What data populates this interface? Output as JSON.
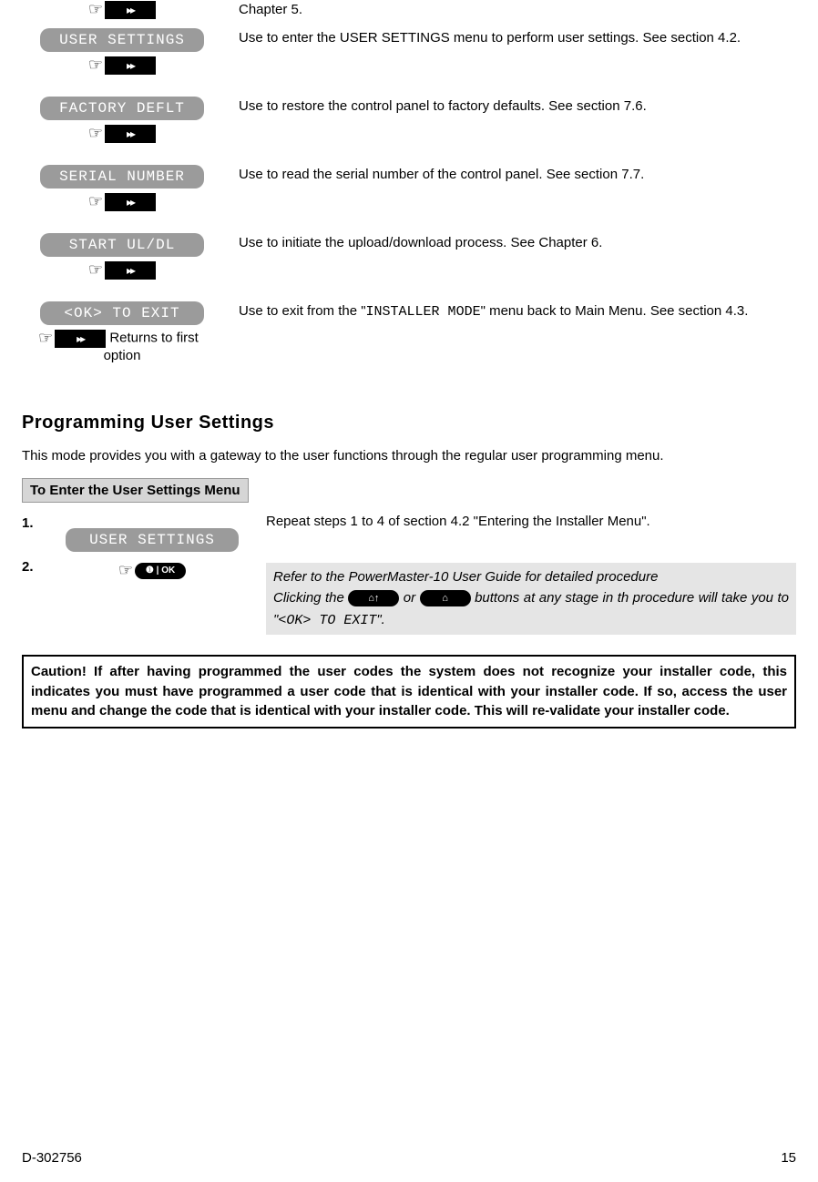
{
  "menu": [
    {
      "label": "",
      "desc_pre": "Chapter 5.",
      "show_hint_before": true,
      "show_label": false,
      "show_hint_after": false
    },
    {
      "label": "USER SETTINGS",
      "desc": "Use to enter the USER SETTINGS menu to perform user settings. See section 4.2.",
      "show_hint_after": true
    },
    {
      "label": "FACTORY DEFLT",
      "desc": "Use to restore the control panel to factory defaults. See section 7.6.",
      "show_hint_after": true
    },
    {
      "label": "SERIAL NUMBER",
      "desc": "Use to read the serial number of the control panel. See section 7.7.",
      "show_hint_after": true
    },
    {
      "label": "START UL/DL",
      "desc": "Use to initiate the upload/download process. See Chapter 6.",
      "show_hint_after": true
    },
    {
      "label": "<OK> TO EXIT",
      "desc_pre": "Use to exit from the \"",
      "desc_mono": "INSTALLER MODE",
      "desc_post": "\" menu back to Main Menu. See section 4.3.",
      "returns1": "Returns to first",
      "returns2": "option",
      "is_exit": true
    }
  ],
  "section": {
    "heading": "Programming User Settings",
    "intro": "This mode provides you with a gateway to the user functions through the regular user programming menu.",
    "sub_header": "To Enter the  User Settings Menu",
    "steps": {
      "s1_num": "1.",
      "s1_label": "USER SETTINGS",
      "s1_text": "Repeat steps 1 to 4 of section 4.2 \"Entering the Installer Menu\".",
      "s2_num": "2.",
      "note_l1": "Refer to the PowerMaster-10 User Guide for detailed procedure",
      "note_l2a": "Clicking the ",
      "note_l2b": " or ",
      "note_l2c": " buttons at any stage in th   procedure will take you to \"",
      "note_mono": "<OK> TO EXIT",
      "note_l2d": "\"."
    },
    "caution": "Caution! If after having programmed the user codes the system does not recognize your installer code, this indicates you must have programmed a user code that is identical with your installer code. If so, access the user menu and change the code that is identical with your installer code. This will re-validate your installer code."
  },
  "footer": {
    "doc": "D-302756",
    "page": "15"
  },
  "icons": {
    "ok_label": "❶ | OK",
    "away_glyph": "⌂↑",
    "home_glyph": "⌂"
  }
}
